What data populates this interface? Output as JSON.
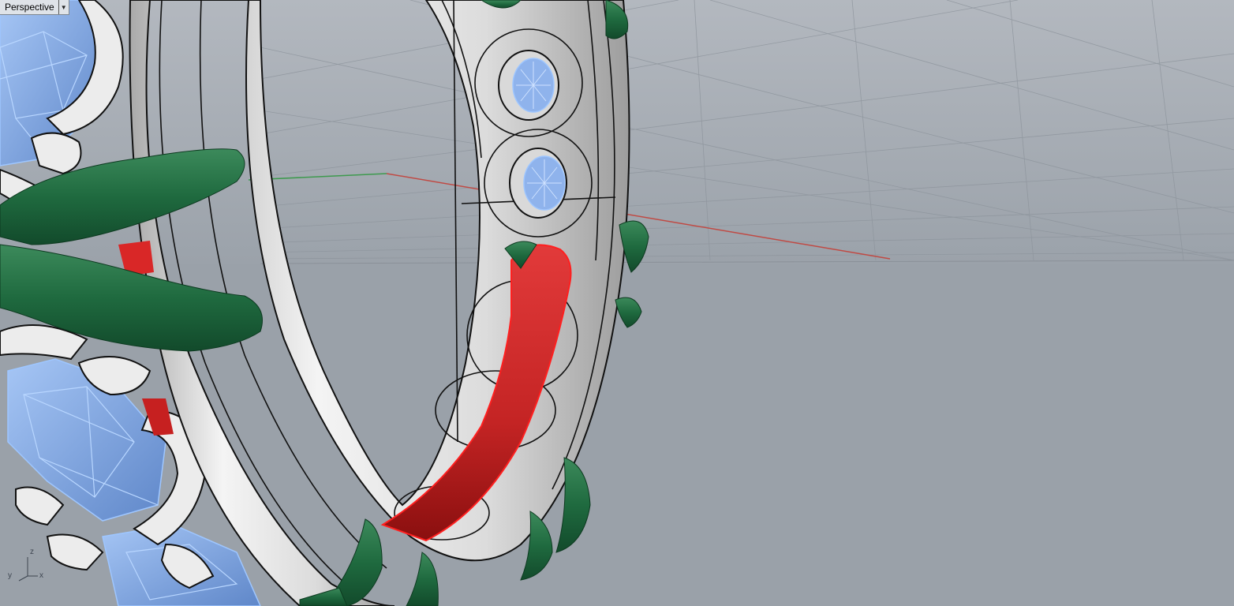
{
  "viewport": {
    "name": "Perspective",
    "menu_icon": "triangle-down-icon"
  },
  "axis_widget": {
    "z": "z",
    "y": "y",
    "x": "x"
  },
  "colors": {
    "background": "#9aa1a9",
    "metal": "#e6e6e6",
    "gem": "#88aee8",
    "gem_wire": "#9ec6ff",
    "leaf": "#226b40",
    "selected": "#d92727",
    "x_axis": "#c04a44",
    "y_axis": "#3e9a4e"
  }
}
